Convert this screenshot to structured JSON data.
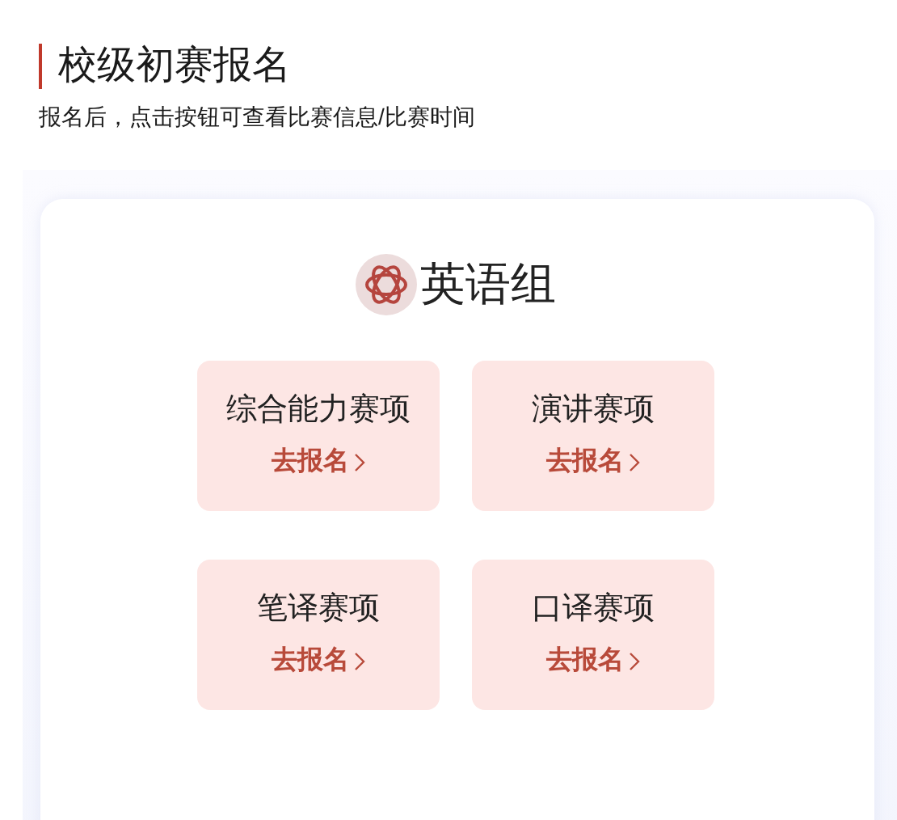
{
  "page": {
    "title": "校级初赛报名",
    "subtitle": "报名后，点击按钮可查看比赛信息/比赛时间"
  },
  "group": {
    "title": "英语组",
    "events": [
      {
        "name": "综合能力赛项",
        "action": "去报名"
      },
      {
        "name": "演讲赛项",
        "action": "去报名"
      },
      {
        "name": "笔译赛项",
        "action": "去报名"
      },
      {
        "name": "口译赛项",
        "action": "去报名"
      }
    ]
  }
}
